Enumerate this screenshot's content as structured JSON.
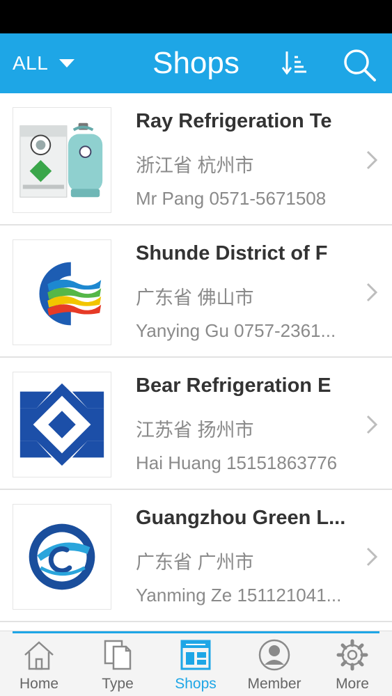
{
  "header": {
    "filter_label": "ALL",
    "title": "Shops",
    "sort_icon": "sort-descending-icon",
    "search_icon": "search-icon"
  },
  "shops": [
    {
      "name": "Ray Refrigeration Te",
      "region": "浙江省 杭州市",
      "contact": "Mr  Pang 0571-5671508",
      "image": "refrigerant-product-photo"
    },
    {
      "name": "Shunde District of F",
      "region": "广东省 佛山市",
      "contact": "Yanying Gu 0757-2361...",
      "image": "colorful-c-logo"
    },
    {
      "name": "Bear Refrigeration E",
      "region": "江苏省 扬州市",
      "contact": "Hai Huang 15151863776",
      "image": "blue-diamond-logo"
    },
    {
      "name": "Guangzhou Green L...",
      "region": "广东省 广州市",
      "contact": "Yanming Ze 151121041...",
      "image": "blue-circle-logo"
    }
  ],
  "tabs": [
    {
      "label": "Home",
      "icon": "home-icon"
    },
    {
      "label": "Type",
      "icon": "documents-icon"
    },
    {
      "label": "Shops",
      "icon": "storefront-icon",
      "active": true
    },
    {
      "label": "Member",
      "icon": "user-icon"
    },
    {
      "label": "More",
      "icon": "gear-icon"
    }
  ],
  "colors": {
    "accent": "#1ea6e6",
    "title_text": "#333333",
    "secondary_text": "#8a8a8a"
  }
}
